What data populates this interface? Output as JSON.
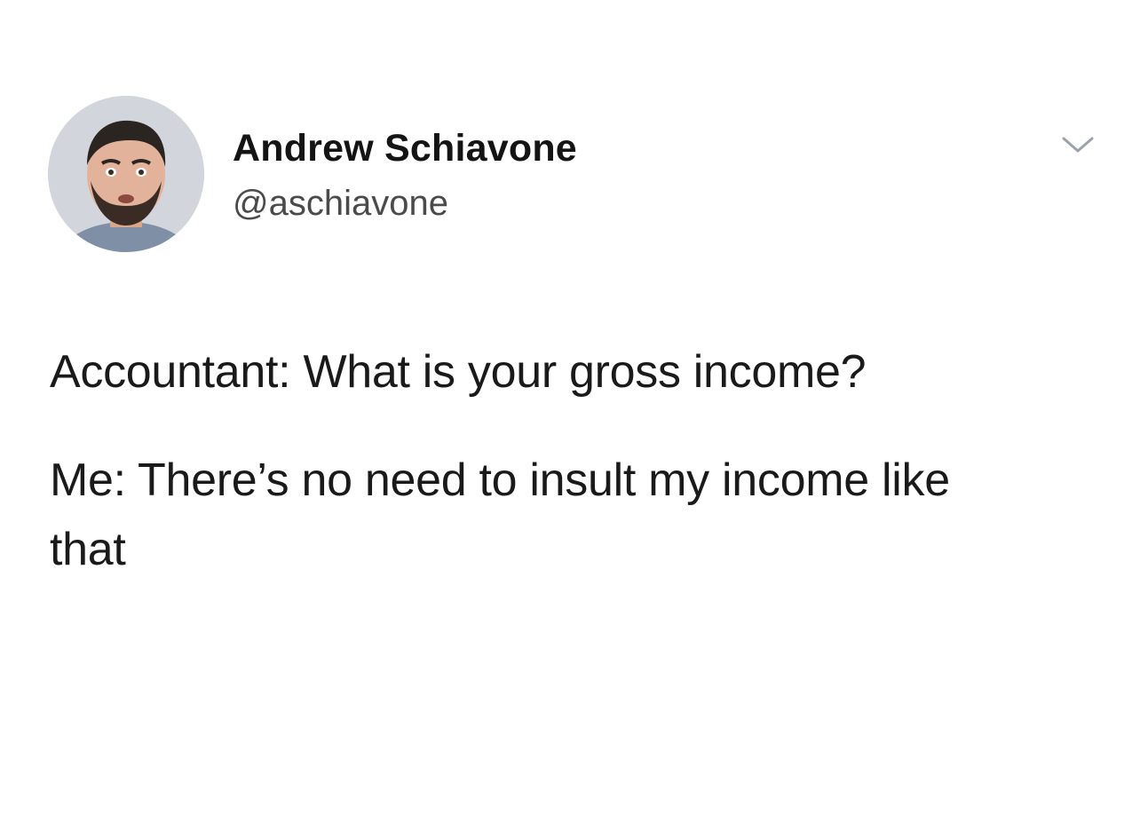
{
  "tweet": {
    "author": {
      "display_name": "Andrew Schiavone",
      "handle": "@aschiavone",
      "avatar_icon": "person-avatar"
    },
    "menu_icon": "chevron-down-icon",
    "paragraphs": [
      "Accountant:  What is your gross income?",
      "Me:  There’s no need to insult my income like that"
    ]
  }
}
